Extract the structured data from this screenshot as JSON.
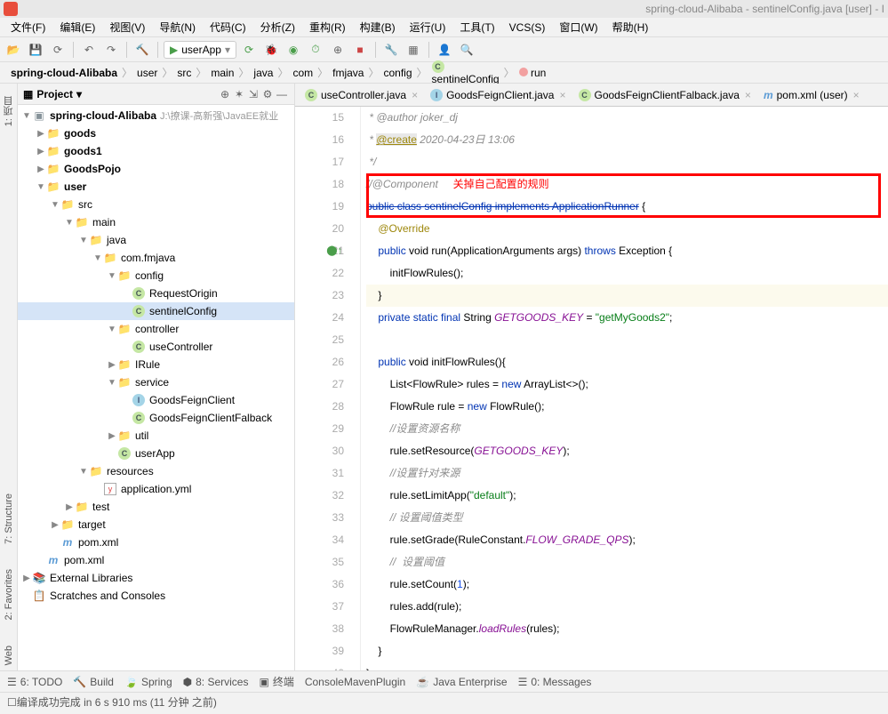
{
  "window_title": "spring-cloud-Alibaba - sentinelConfig.java [user] - I",
  "menu": [
    "文件(F)",
    "编辑(E)",
    "视图(V)",
    "导航(N)",
    "代码(C)",
    "分析(Z)",
    "重构(R)",
    "构建(B)",
    "运行(U)",
    "工具(T)",
    "VCS(S)",
    "窗口(W)",
    "帮助(H)"
  ],
  "run_config": "userApp",
  "breadcrumbs": [
    "spring-cloud-Alibaba",
    "user",
    "src",
    "main",
    "java",
    "com",
    "fmjava",
    "config",
    "sentinelConfig",
    "run"
  ],
  "panel_title": "Project",
  "tree": {
    "root": "spring-cloud-Alibaba",
    "root_path": "J:\\撩课-高新强\\JavaEE就业",
    "goods": "goods",
    "goods1": "goods1",
    "goodspojo": "GoodsPojo",
    "user": "user",
    "src": "src",
    "main": "main",
    "java": "java",
    "pkg": "com.fmjava",
    "config": "config",
    "requestorigin": "RequestOrigin",
    "sentinelconfig": "sentinelConfig",
    "controller": "controller",
    "usecontroller": "useController",
    "irule": "IRule",
    "service": "service",
    "gfc": "GoodsFeignClient",
    "gfcf": "GoodsFeignClientFalback",
    "util": "util",
    "userapp": "userApp",
    "resources": "resources",
    "appyml": "application.yml",
    "test": "test",
    "target": "target",
    "pomuser": "pom.xml",
    "pomroot": "pom.xml",
    "extlib": "External Libraries",
    "scratch": "Scratches and Consoles"
  },
  "tabs": [
    {
      "label": "useController.java",
      "icon": "c"
    },
    {
      "label": "GoodsFeignClient.java",
      "icon": "i"
    },
    {
      "label": "GoodsFeignClientFalback.java",
      "icon": "c"
    },
    {
      "label": "pom.xml (user)",
      "icon": "m"
    }
  ],
  "code": {
    "l15": " * @author joker_dj",
    "l16a": " * ",
    "l16b": "@create",
    "l16c": " 2020-04-23日 13:06",
    "l17": " */",
    "l18": "//@Component",
    "l18r": "关掉自己配置的规则",
    "l19a": "public class sentinelConfig implements ApplicationRunner",
    "l19b": " {",
    "l20": "@Override",
    "l21a": "public",
    "l21b": " void ",
    "l21c": "run",
    "l21d": "(ApplicationArguments args) ",
    "l21e": "throws",
    "l21f": " Exception {",
    "l22": "initFlowRules();",
    "l23": "}",
    "l24a": "private static final",
    "l24b": " String ",
    "l24c": "GETGOODS_KEY",
    "l24d": " = ",
    "l24e": "\"getMyGoods2\"",
    "l24f": ";",
    "l26a": "public",
    "l26b": " void ",
    "l26c": "initFlowRules",
    "l26d": "(){",
    "l27a": "List<FlowRule> rules = ",
    "l27b": "new",
    "l27c": " ArrayList<>();",
    "l28a": "FlowRule rule = ",
    "l28b": "new",
    "l28c": " FlowRule();",
    "l29": "//设置资源名称",
    "l30a": "rule.setResource(",
    "l30b": "GETGOODS_KEY",
    "l30c": ");",
    "l31": "//设置针对来源",
    "l32a": "rule.setLimitApp(",
    "l32b": "\"default\"",
    "l32c": ");",
    "l33": "// 设置阈值类型",
    "l34a": "rule.setGrade(RuleConstant.",
    "l34b": "FLOW_GRADE_QPS",
    "l34c": ");",
    "l35": "//  设置阈值",
    "l36a": "rule.setCount(",
    "l36b": "1",
    "l36c": ");",
    "l37": "rules.add(rule);",
    "l38a": "FlowRuleManager.",
    "l38b": "loadRules",
    "l38c": "(rules);",
    "l39": "}",
    "l40": "}"
  },
  "bottom": {
    "todo": "6: TODO",
    "build": "Build",
    "spring": "Spring",
    "services": "8: Services",
    "terminal": "终端",
    "cmp": "ConsoleMavenPlugin",
    "je": "Java Enterprise",
    "msg": "0: Messages"
  },
  "status": "编译成功完成 in 6 s 910 ms (11 分钟 之前)",
  "side": {
    "project": "1: 项目",
    "structure": "7: Structure",
    "favorites": "2: Favorites",
    "web": "Web"
  }
}
